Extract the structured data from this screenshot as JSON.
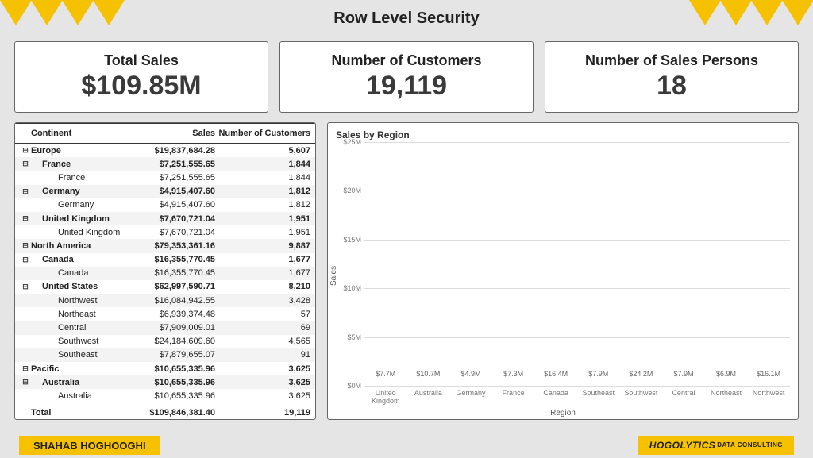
{
  "title": "Row Level Security",
  "kpis": {
    "total_sales": {
      "label": "Total Sales",
      "value": "$109.85M"
    },
    "customers": {
      "label": "Number of Customers",
      "value": "19,119"
    },
    "sales_persons": {
      "label": "Number of Sales Persons",
      "value": "18"
    }
  },
  "table": {
    "headers": {
      "continent": "Continent",
      "sales": "Sales",
      "customers": "Number of Customers"
    },
    "rows": [
      {
        "lvl": 0,
        "toggle": "⊟",
        "name": "Europe",
        "sales": "$19,837,684.28",
        "cust": "5,607"
      },
      {
        "lvl": 1,
        "toggle": "⊟",
        "name": "France",
        "sales": "$7,251,555.65",
        "cust": "1,844"
      },
      {
        "lvl": 2,
        "toggle": "",
        "name": "France",
        "sales": "$7,251,555.65",
        "cust": "1,844"
      },
      {
        "lvl": 1,
        "toggle": "⊟",
        "name": "Germany",
        "sales": "$4,915,407.60",
        "cust": "1,812"
      },
      {
        "lvl": 2,
        "toggle": "",
        "name": "Germany",
        "sales": "$4,915,407.60",
        "cust": "1,812"
      },
      {
        "lvl": 1,
        "toggle": "⊟",
        "name": "United Kingdom",
        "sales": "$7,670,721.04",
        "cust": "1,951"
      },
      {
        "lvl": 2,
        "toggle": "",
        "name": "United Kingdom",
        "sales": "$7,670,721.04",
        "cust": "1,951"
      },
      {
        "lvl": 0,
        "toggle": "⊟",
        "name": "North America",
        "sales": "$79,353,361.16",
        "cust": "9,887"
      },
      {
        "lvl": 1,
        "toggle": "⊟",
        "name": "Canada",
        "sales": "$16,355,770.45",
        "cust": "1,677"
      },
      {
        "lvl": 2,
        "toggle": "",
        "name": "Canada",
        "sales": "$16,355,770.45",
        "cust": "1,677"
      },
      {
        "lvl": 1,
        "toggle": "⊟",
        "name": "United States",
        "sales": "$62,997,590.71",
        "cust": "8,210"
      },
      {
        "lvl": 2,
        "toggle": "",
        "name": "Northwest",
        "sales": "$16,084,942.55",
        "cust": "3,428"
      },
      {
        "lvl": 2,
        "toggle": "",
        "name": "Northeast",
        "sales": "$6,939,374.48",
        "cust": "57"
      },
      {
        "lvl": 2,
        "toggle": "",
        "name": "Central",
        "sales": "$7,909,009.01",
        "cust": "69"
      },
      {
        "lvl": 2,
        "toggle": "",
        "name": "Southwest",
        "sales": "$24,184,609.60",
        "cust": "4,565"
      },
      {
        "lvl": 2,
        "toggle": "",
        "name": "Southeast",
        "sales": "$7,879,655.07",
        "cust": "91"
      },
      {
        "lvl": 0,
        "toggle": "⊟",
        "name": "Pacific",
        "sales": "$10,655,335.96",
        "cust": "3,625"
      },
      {
        "lvl": 1,
        "toggle": "⊟",
        "name": "Australia",
        "sales": "$10,655,335.96",
        "cust": "3,625"
      },
      {
        "lvl": 2,
        "toggle": "",
        "name": "Australia",
        "sales": "$10,655,335.96",
        "cust": "3,625"
      }
    ],
    "total": {
      "name": "Total",
      "sales": "$109,846,381.40",
      "cust": "19,119"
    }
  },
  "chart_data": {
    "type": "bar",
    "title": "Sales by Region",
    "xlabel": "Region",
    "ylabel": "Sales",
    "ylim": [
      0,
      25
    ],
    "y_unit": "M",
    "y_prefix": "$",
    "yticks": [
      0,
      5,
      10,
      15,
      20,
      25
    ],
    "ytick_labels": [
      "$0M",
      "$5M",
      "$10M",
      "$15M",
      "$20M",
      "$25M"
    ],
    "categories": [
      "United Kingdom",
      "Australia",
      "Germany",
      "France",
      "Canada",
      "Southeast",
      "Southwest",
      "Central",
      "Northeast",
      "Northwest"
    ],
    "values": [
      7.7,
      10.7,
      4.9,
      7.3,
      16.4,
      7.9,
      24.2,
      7.9,
      6.9,
      16.1
    ],
    "value_labels": [
      "$7.7M",
      "$10.7M",
      "$4.9M",
      "$7.3M",
      "$16.4M",
      "$7.9M",
      "$24.2M",
      "$7.9M",
      "$6.9M",
      "$16.1M"
    ],
    "highlight_index": 6,
    "series": [
      {
        "name": "Sales",
        "values": [
          7.7,
          10.7,
          4.9,
          7.3,
          16.4,
          7.9,
          24.2,
          7.9,
          6.9,
          16.1
        ]
      }
    ]
  },
  "footer": {
    "author": "SHAHAB HOGHOOGHI",
    "brand_main": "HOGOLYTICS",
    "brand_sub": "DATA CONSULTING"
  }
}
